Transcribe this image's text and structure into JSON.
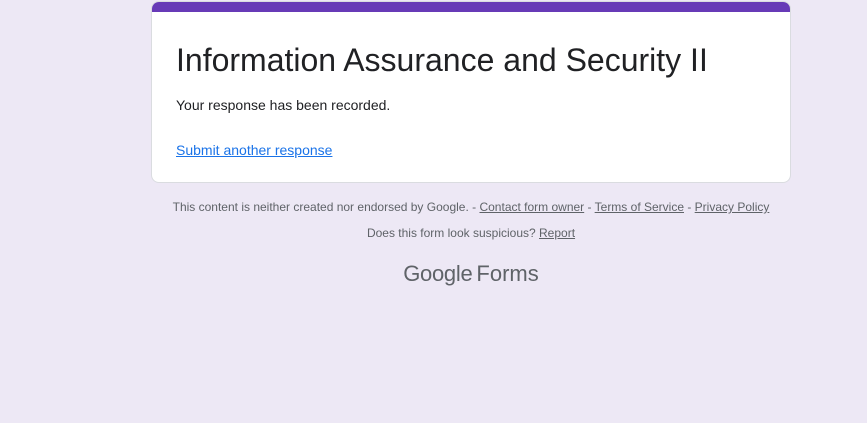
{
  "form": {
    "title": "Information Assurance and Security II",
    "confirmation_message": "Your response has been recorded.",
    "submit_another_label": "Submit another response"
  },
  "footer": {
    "disclaimer_text": "This content is neither created nor endorsed by Google. - ",
    "contact_owner_label": "Contact form owner",
    "separator_1": " - ",
    "terms_label": "Terms of Service",
    "separator_2": " - ",
    "privacy_label": "Privacy Policy",
    "suspicious_text": "Does this form look suspicious? ",
    "report_label": "Report"
  },
  "logo": {
    "brand": "Google",
    "product": "Forms"
  },
  "colors": {
    "accent": "#673ab7",
    "background": "#ede8f5",
    "link": "#1a73e8"
  }
}
